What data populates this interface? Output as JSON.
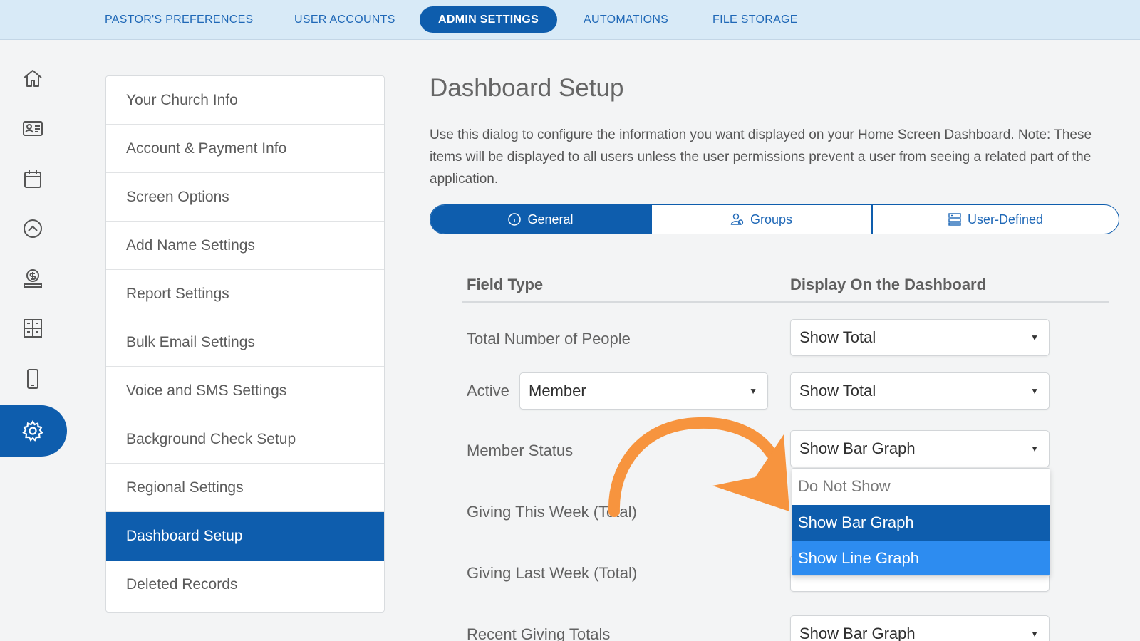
{
  "topnav": {
    "tabs": [
      {
        "label": "PASTOR'S PREFERENCES"
      },
      {
        "label": "USER ACCOUNTS"
      },
      {
        "label": "ADMIN SETTINGS",
        "active": true
      },
      {
        "label": "AUTOMATIONS"
      },
      {
        "label": "FILE STORAGE"
      }
    ]
  },
  "rail": {
    "icons": [
      "home-icon",
      "contact-card-icon",
      "calendar-icon",
      "chevron-up-circle-icon",
      "giving-hand-icon",
      "grid-icon",
      "mobile-icon",
      "gear-icon"
    ],
    "active": "gear-icon"
  },
  "menu": {
    "items": [
      {
        "label": "Your Church Info"
      },
      {
        "label": "Account & Payment Info"
      },
      {
        "label": "Screen Options"
      },
      {
        "label": "Add Name Settings"
      },
      {
        "label": "Report Settings"
      },
      {
        "label": "Bulk Email Settings"
      },
      {
        "label": "Voice and SMS Settings"
      },
      {
        "label": "Background Check Setup"
      },
      {
        "label": "Regional Settings"
      },
      {
        "label": "Dashboard Setup",
        "active": true
      },
      {
        "label": "Deleted Records"
      }
    ]
  },
  "main": {
    "title": "Dashboard Setup",
    "description": "Use this dialog to configure the information you want displayed on your Home Screen Dashboard. Note: These items will be displayed to all users unless the user permissions prevent a user from seeing a related part of the application.",
    "segments": [
      {
        "label": "General",
        "icon": "info-icon",
        "active": true
      },
      {
        "label": "Groups",
        "icon": "groups-icon"
      },
      {
        "label": "User-Defined",
        "icon": "list-icon"
      }
    ],
    "columns": {
      "field_type": "Field Type",
      "display": "Display On the Dashboard"
    },
    "rows": {
      "total_people": {
        "label": "Total Number of People",
        "value": "Show Total"
      },
      "active": {
        "label": "Active",
        "filter": "Member",
        "value": "Show Total"
      },
      "member_status": {
        "label": "Member Status",
        "value": "Show Bar Graph"
      },
      "giving_this_week": {
        "label": "Giving This Week (Total)"
      },
      "giving_last_week": {
        "label": "Giving Last Week (Total)"
      },
      "recent_giving": {
        "label": "Recent Giving Totals",
        "value": "Show Bar Graph"
      }
    },
    "dropdown": {
      "options": [
        {
          "label": "Do Not Show"
        },
        {
          "label": "Show Bar Graph",
          "state": "selected"
        },
        {
          "label": "Show Line Graph",
          "state": "hover"
        }
      ]
    }
  },
  "colors": {
    "primary": "#0e5dad",
    "nav_bg": "#d8eaf7",
    "hover": "#2d8cf0",
    "annotation_arrow": "#f7943e"
  }
}
